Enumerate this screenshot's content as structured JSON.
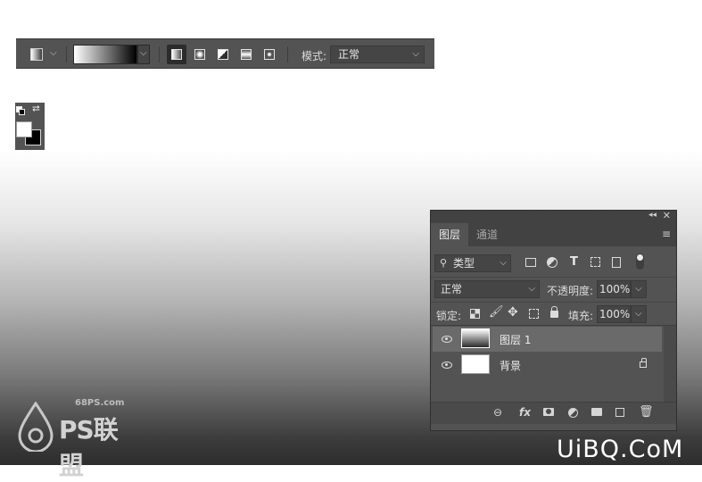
{
  "toolbar": {
    "mode_label": "模式:",
    "mode_value": "正常",
    "gradient_types": [
      "linear",
      "radial",
      "angle",
      "reflected",
      "diamond"
    ],
    "active_gradient_type": "linear"
  },
  "colors": {
    "foreground": "#ffffff",
    "background": "#000000",
    "panel_bg": "#535353",
    "panel_dark": "#424242",
    "selected_row": "#6a6a6a"
  },
  "layers_panel": {
    "tabs": [
      "图层",
      "通道"
    ],
    "filter_kind": "类型",
    "blend_mode": "正常",
    "opacity_label": "不透明度:",
    "opacity_value": "100%",
    "lock_label": "锁定:",
    "fill_label": "填充:",
    "fill_value": "100%",
    "layers": [
      {
        "name": "图层 1",
        "selected": true,
        "thumbnail": "gradient",
        "locked": false
      },
      {
        "name": "背景",
        "selected": false,
        "thumbnail": "white",
        "locked": true
      }
    ],
    "footer_icons": [
      "link-icon",
      "fx-icon",
      "mask-icon",
      "adjustment-icon",
      "folder-icon",
      "new-layer-icon",
      "trash-icon"
    ]
  },
  "watermarks": {
    "site": "68PS.com",
    "logo_text": "PS联盟",
    "brand": "UiBQ.CoM"
  }
}
